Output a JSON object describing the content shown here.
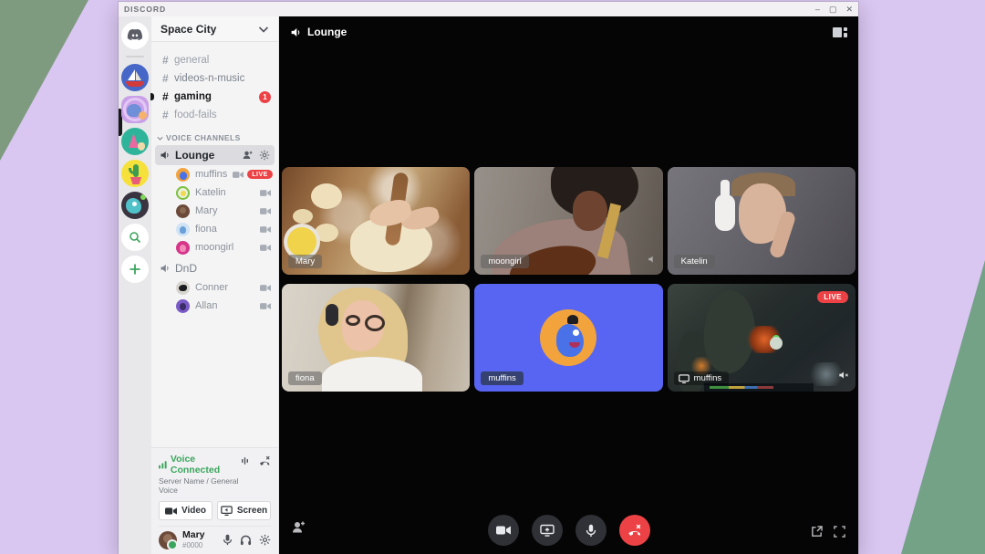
{
  "titlebar": {
    "title": "DISCORD",
    "minimize": "–",
    "maximize": "▢",
    "close": "✕"
  },
  "glyphs": {
    "hash": "#"
  },
  "sidebar": {
    "server_name": "Space City",
    "text_channels": [
      {
        "label": "general"
      },
      {
        "label": "videos-n-music"
      },
      {
        "label": "gaming",
        "badge": "1"
      },
      {
        "label": "food-fails"
      }
    ],
    "voice_section": "VOICE CHANNELS",
    "lounge": {
      "label": "Lounge"
    },
    "lounge_members": [
      {
        "name": "muffins",
        "live": "LIVE"
      },
      {
        "name": "Katelin"
      },
      {
        "name": "Mary"
      },
      {
        "name": "fiona"
      },
      {
        "name": "moongirl"
      }
    ],
    "dnd": {
      "label": "DnD"
    },
    "dnd_members": [
      {
        "name": "Conner"
      },
      {
        "name": "Allan"
      }
    ],
    "voice_status": {
      "title": "Voice Connected",
      "subtitle": "Server Name / General Voice"
    },
    "buttons": {
      "video": "Video",
      "screen": "Screen"
    },
    "user": {
      "name": "Mary",
      "tag": "#0000"
    }
  },
  "main": {
    "header": {
      "title": "Lounge"
    },
    "tiles": [
      {
        "name": "Mary"
      },
      {
        "name": "moongirl"
      },
      {
        "name": "Katelin"
      },
      {
        "name": "fiona"
      },
      {
        "name": "muffins"
      },
      {
        "name": "muffins",
        "live": "LIVE"
      }
    ]
  },
  "icons": {
    "speaker": "speaker-cone",
    "chevron": "chevron-down",
    "camera": "video-camera",
    "gear": "settings-gear",
    "person_add": "user-plus",
    "mic": "microphone",
    "headphones": "headphones",
    "call_end": "phone-disconnect",
    "signal": "voice-signal-bars",
    "noise": "soundwave",
    "screen": "monitor",
    "grid": "grid-view",
    "popout": "pop-out",
    "fullscreen": "fullscreen",
    "search": "magnifier",
    "add": "plus",
    "muted": "speaker-muted"
  },
  "colors": {
    "blurple": "#5865f2",
    "red": "#ed4245",
    "green": "#3ba55d",
    "lavender": "#d9c6f1",
    "sage": "#73a287"
  }
}
